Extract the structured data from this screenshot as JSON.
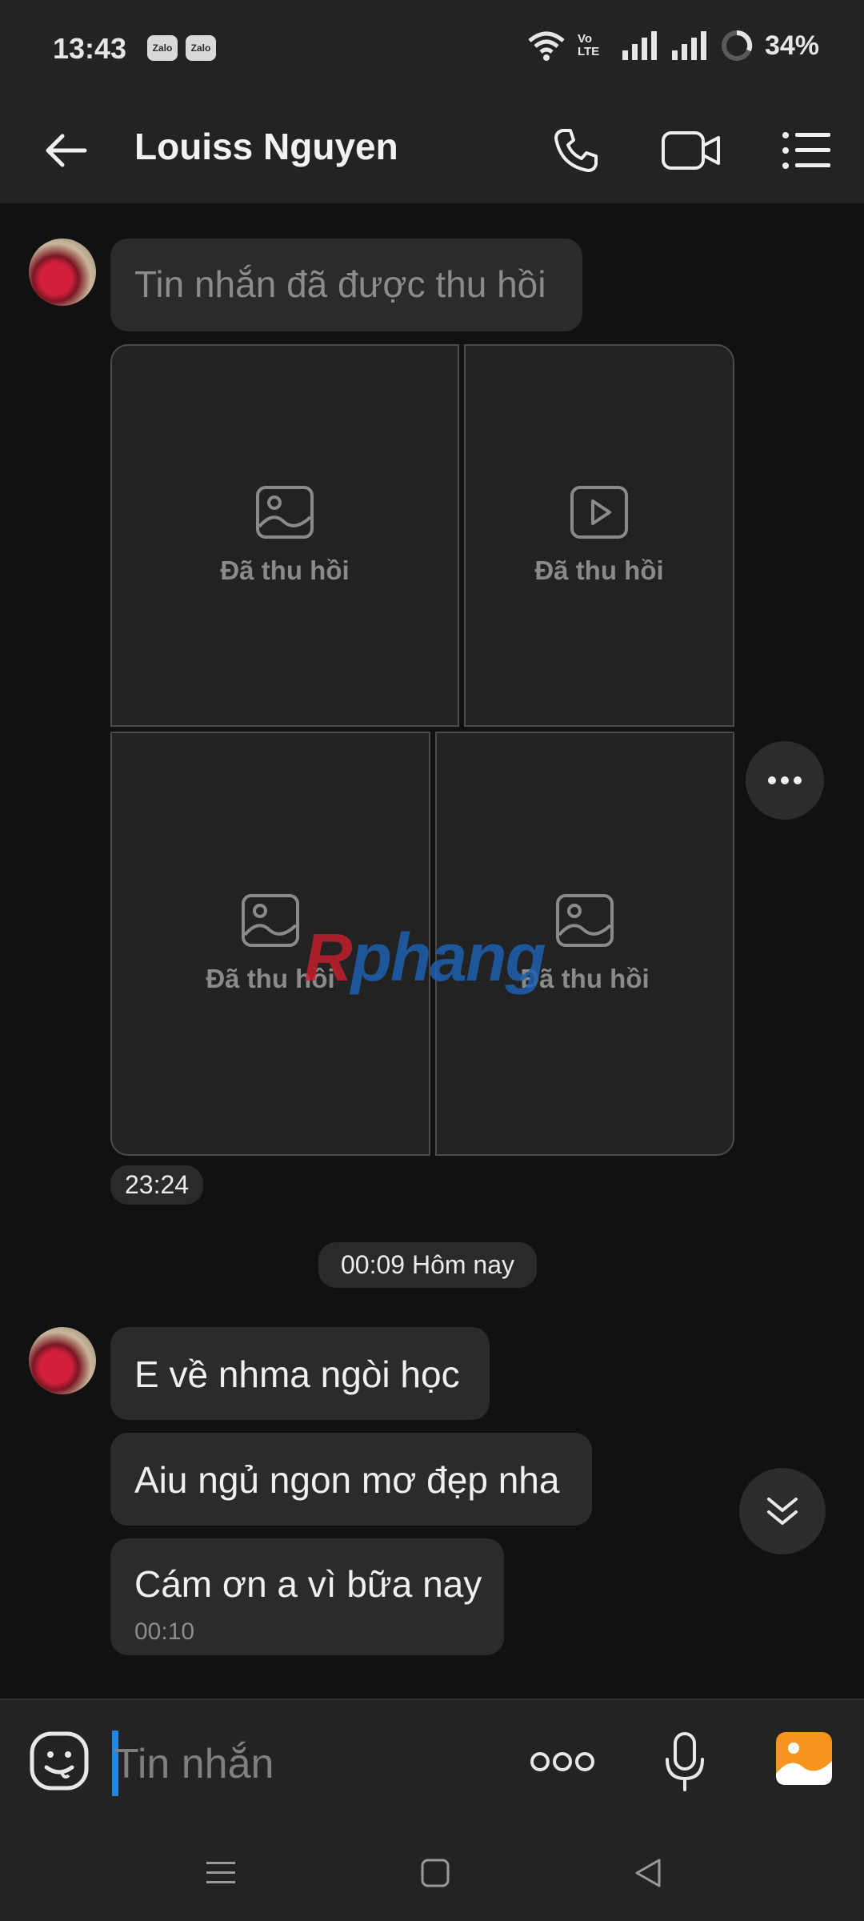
{
  "status_bar": {
    "time": "13:43",
    "app_badges": [
      "Zalo",
      "Zalo"
    ],
    "network_label": "Vo LTE",
    "battery": "34%"
  },
  "header": {
    "contact_name": "Louiss Nguyen",
    "icons": [
      "back-arrow-icon",
      "phone-icon",
      "video-call-icon",
      "menu-list-icon"
    ]
  },
  "messages": {
    "recalled_text": "Tin nhắn đã được thu hồi",
    "recalled_media": [
      {
        "type": "image",
        "label": "Đã thu hồi"
      },
      {
        "type": "video",
        "label": "Đã thu hồi"
      },
      {
        "type": "image",
        "label": "Đã thu hồi"
      },
      {
        "type": "image",
        "label": "Đã thu hồi"
      }
    ],
    "media_time": "23:24",
    "date_separator": "00:09 Hôm nay",
    "text_messages": [
      {
        "text": "E về nhma ngòi học"
      },
      {
        "text": "Aiu ngủ ngon mơ đẹp nha"
      },
      {
        "text": "Cám ơn a vì bữa nay",
        "time": "00:10"
      }
    ]
  },
  "input": {
    "placeholder": "Tin nhắn",
    "accent": "#1e88e5"
  },
  "watermark": {
    "prefix": "R",
    "text": "phang"
  },
  "colors": {
    "background": "#111111",
    "bubble": "#2b2b2b",
    "bar": "#232323"
  }
}
